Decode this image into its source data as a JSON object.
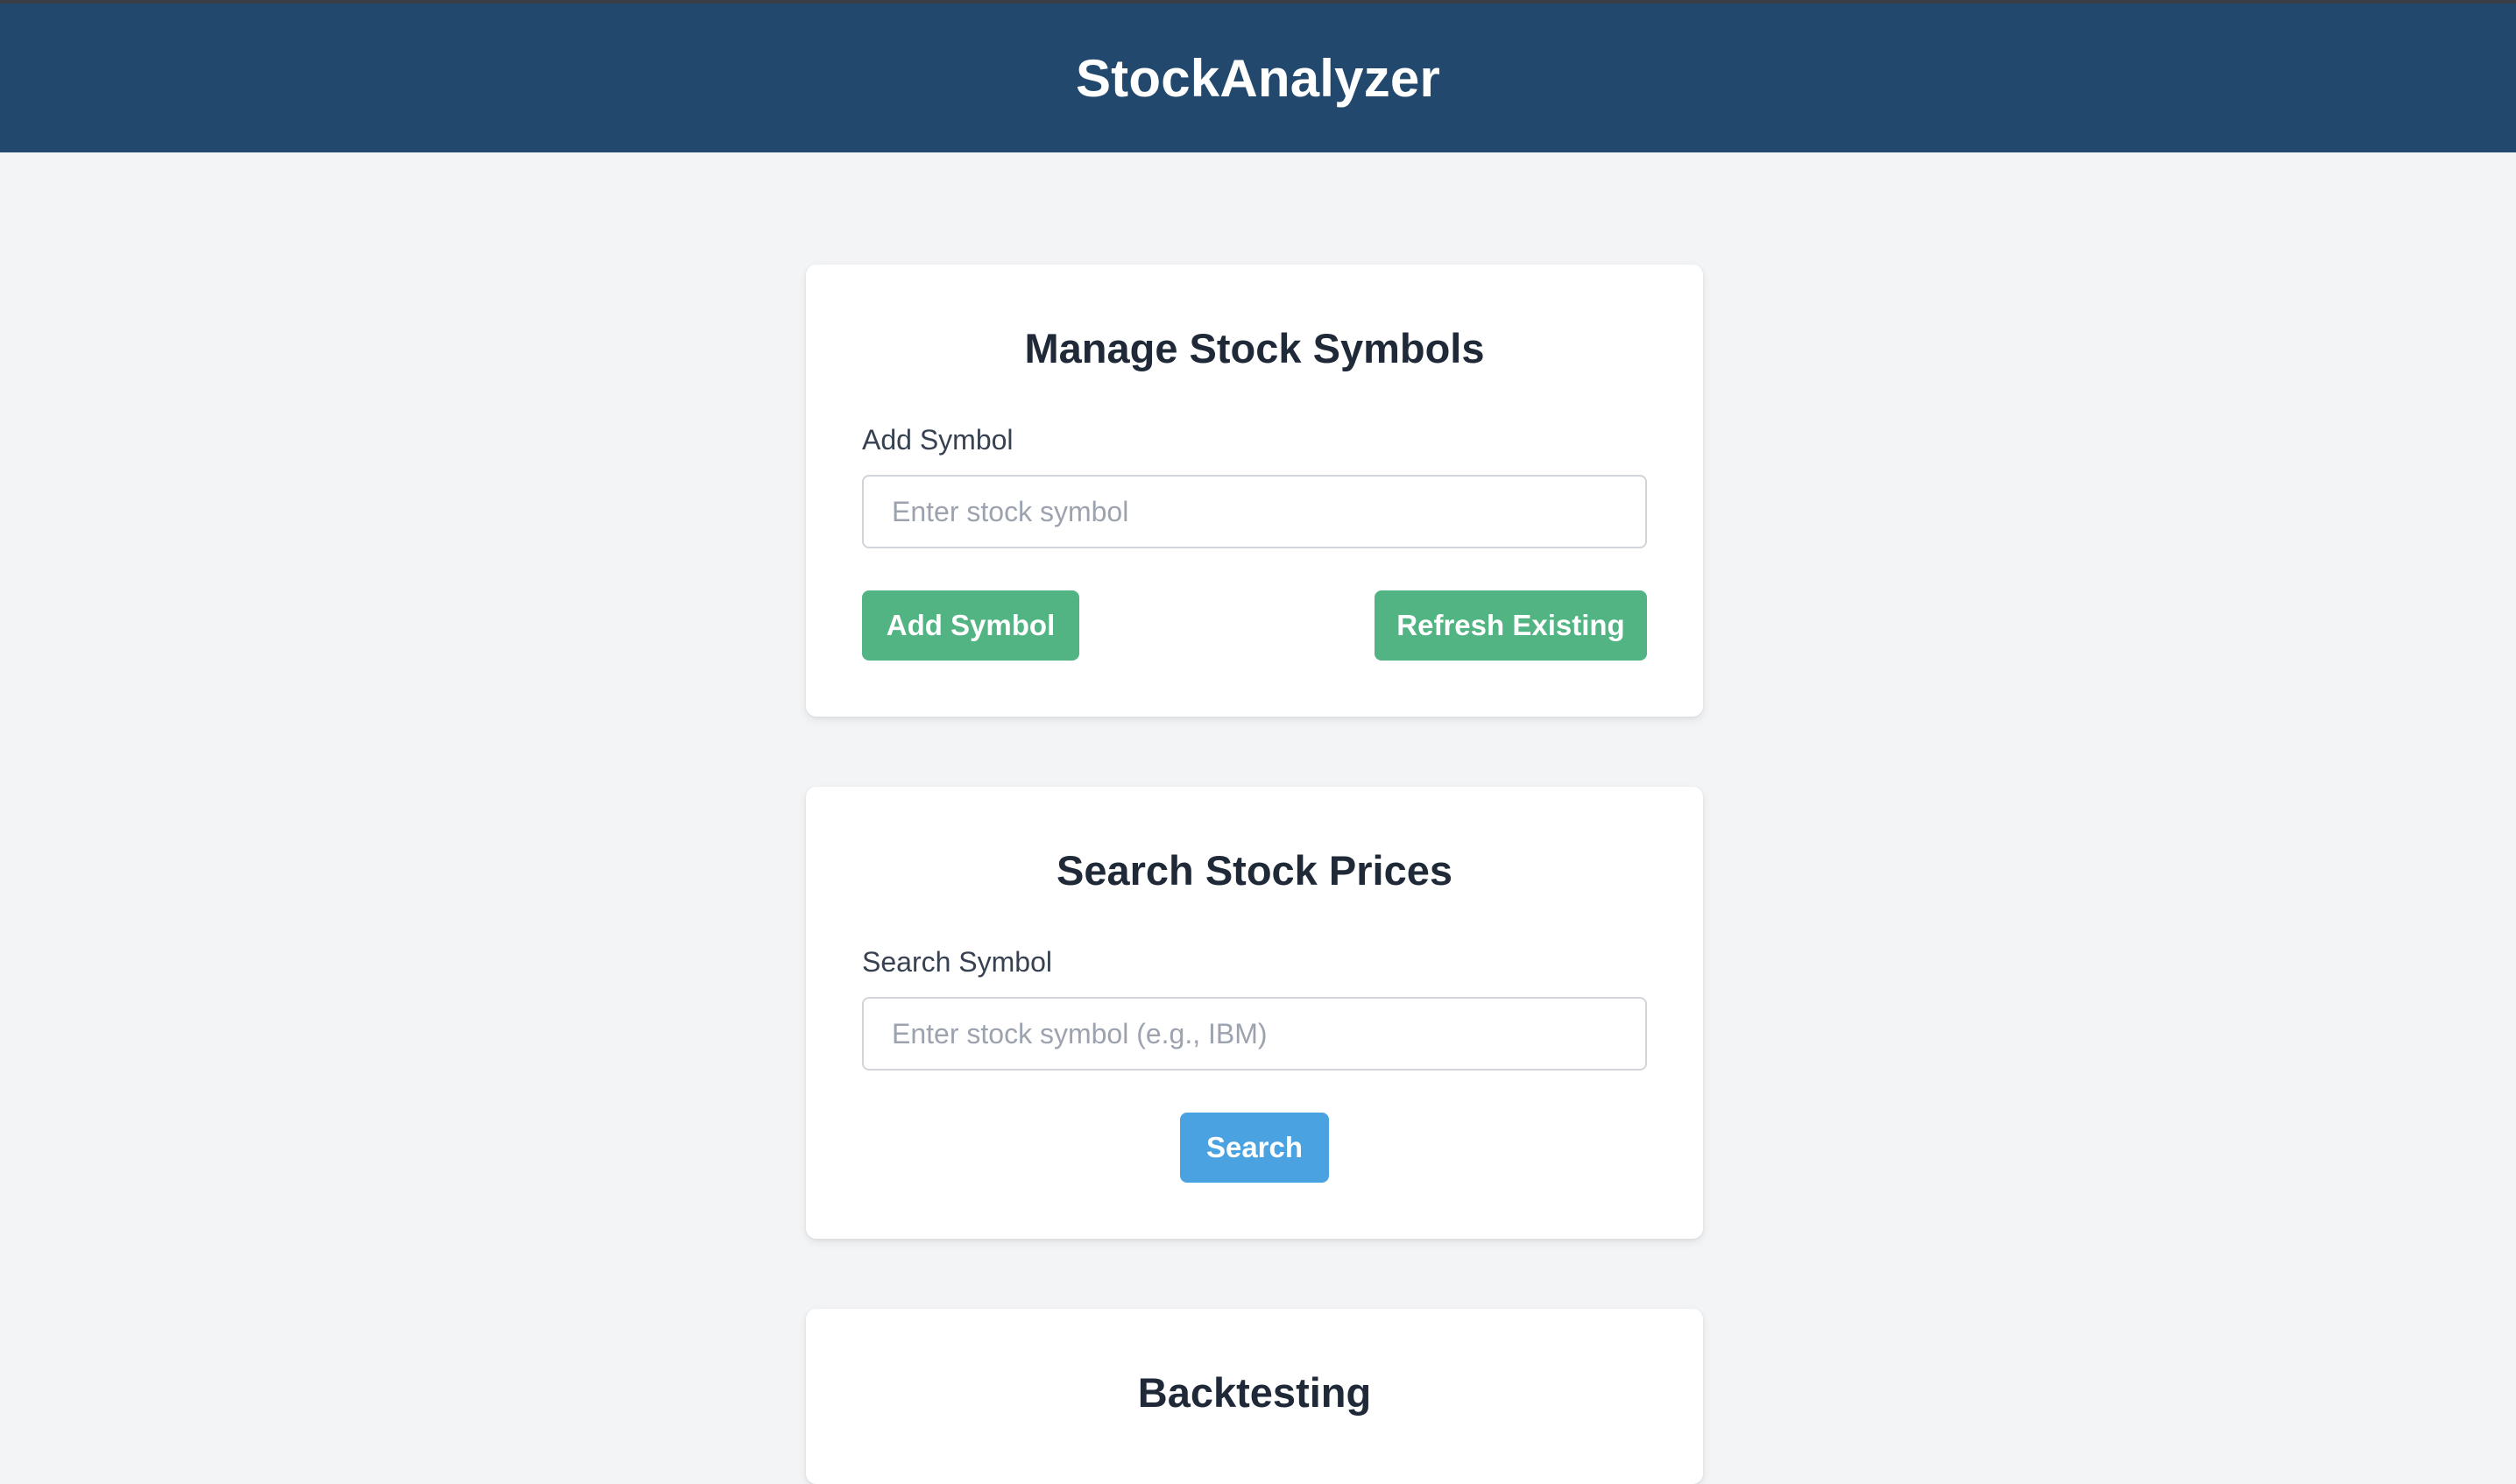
{
  "header": {
    "title": "StockAnalyzer"
  },
  "manage": {
    "title": "Manage Stock Symbols",
    "label": "Add Symbol",
    "input_value": "",
    "input_placeholder": "Enter stock symbol",
    "add_button": "Add Symbol",
    "refresh_button": "Refresh Existing"
  },
  "search": {
    "title": "Search Stock Prices",
    "label": "Search Symbol",
    "input_value": "",
    "input_placeholder": "Enter stock symbol (e.g., IBM)",
    "search_button": "Search"
  },
  "backtesting": {
    "title": "Backtesting"
  },
  "colors": {
    "header_bg": "#22496d",
    "page_bg": "#f3f4f6",
    "primary_green": "#52b383",
    "primary_blue": "#4aa3e0"
  }
}
